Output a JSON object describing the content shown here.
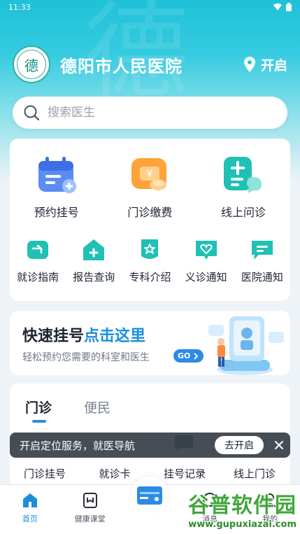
{
  "status_bar": {
    "time": "11:33"
  },
  "header": {
    "hospital_name": "德阳市人民医院",
    "location_label": "开启",
    "logo_glyph": "德"
  },
  "search": {
    "placeholder": "搜索医生"
  },
  "main_services": [
    {
      "label": "预约挂号",
      "icon": "calendar-icon"
    },
    {
      "label": "门诊缴费",
      "icon": "payment-icon"
    },
    {
      "label": "线上问诊",
      "icon": "consult-icon"
    }
  ],
  "sub_services": [
    {
      "label": "就诊指南",
      "icon": "guide-icon"
    },
    {
      "label": "报告查询",
      "icon": "report-icon"
    },
    {
      "label": "专科介绍",
      "icon": "specialty-icon"
    },
    {
      "label": "义诊通知",
      "icon": "free-clinic-icon"
    },
    {
      "label": "医院通知",
      "icon": "notice-icon"
    }
  ],
  "quick_register": {
    "title_main": "快速挂号",
    "title_highlight": "点击这里",
    "subtitle": "轻松预约您需要的科室和医生",
    "go_label": "GO"
  },
  "tabs": [
    {
      "label": "门诊",
      "active": true
    },
    {
      "label": "便民",
      "active": false
    }
  ],
  "outpatient_items": [
    {
      "label": "门诊挂号"
    },
    {
      "label": "就诊卡"
    },
    {
      "label": "挂号记录"
    },
    {
      "label": "线上门诊"
    }
  ],
  "toast": {
    "message": "开启定位服务，就医导航",
    "action_label": "去开启"
  },
  "bottom_nav": [
    {
      "label": "首页",
      "active": true,
      "icon": "home-icon"
    },
    {
      "label": "健康课堂",
      "active": false,
      "icon": "classroom-icon"
    },
    {
      "label": "",
      "active": false,
      "icon": "card-icon"
    },
    {
      "label": "消息",
      "active": false,
      "icon": "message-icon"
    },
    {
      "label": "我的",
      "active": false,
      "icon": "profile-icon"
    }
  ],
  "watermark": {
    "title": "谷普软件园",
    "url": "www.gupuxiazai.com"
  },
  "colors": {
    "brand_cyan": "#1fc1d8",
    "accent_blue": "#2b8be6",
    "icon_teal": "#20c1b4"
  }
}
